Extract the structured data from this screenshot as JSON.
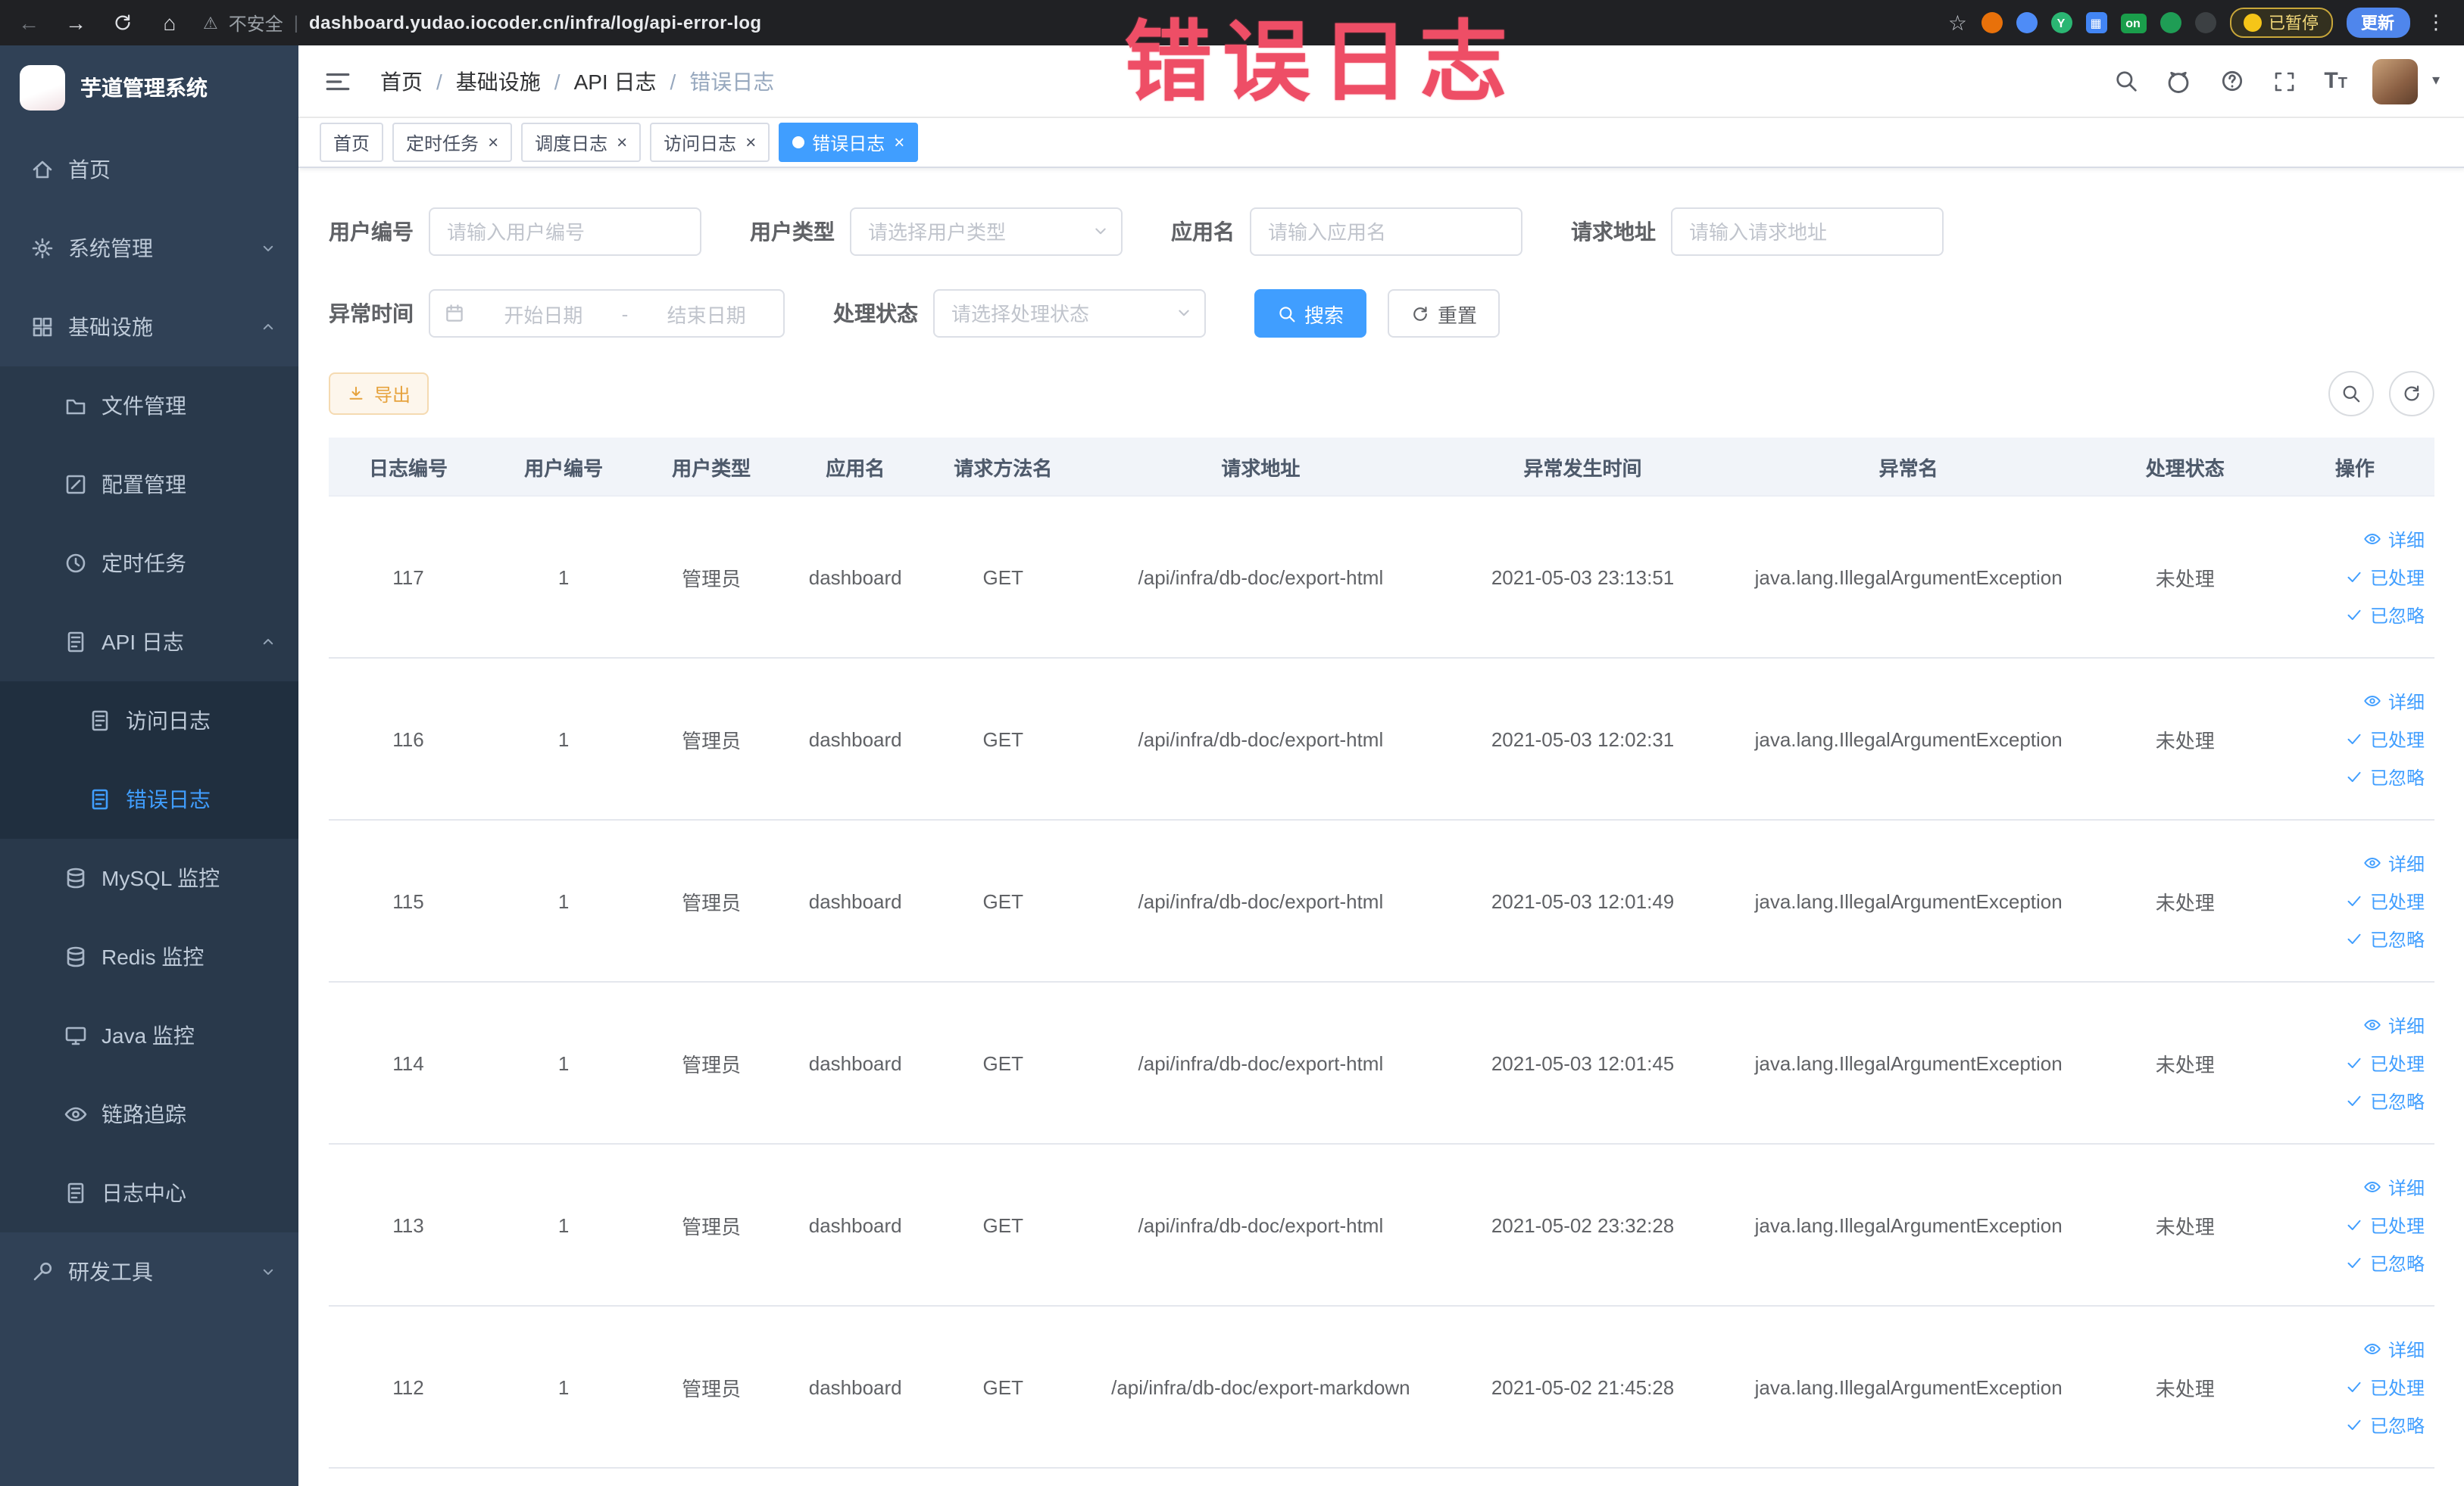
{
  "browser": {
    "security_label": "不安全",
    "url": "dashboard.yudao.iocoder.cn/infra/log/api-error-log",
    "paused_label": "已暂停",
    "update_label": "更新",
    "on_badge": "on"
  },
  "overlay": {
    "title": "错误日志"
  },
  "sidebar": {
    "logo_title": "芋道管理系统",
    "items": [
      {
        "key": "home",
        "label": "首页",
        "icon": "home",
        "level": 1
      },
      {
        "key": "system-mgmt",
        "label": "系统管理",
        "icon": "gear",
        "level": 1,
        "arrow": "down"
      },
      {
        "key": "infrastructure",
        "label": "基础设施",
        "icon": "grid",
        "level": 1,
        "arrow": "up"
      },
      {
        "key": "file-mgmt",
        "label": "文件管理",
        "icon": "folder",
        "level": 2
      },
      {
        "key": "config-mgmt",
        "label": "配置管理",
        "icon": "edit",
        "level": 2
      },
      {
        "key": "scheduled-task",
        "label": "定时任务",
        "icon": "clock",
        "level": 2
      },
      {
        "key": "api-log",
        "label": "API 日志",
        "icon": "doc",
        "level": 2,
        "arrow": "up"
      },
      {
        "key": "access-log",
        "label": "访问日志",
        "icon": "doc",
        "level": 3
      },
      {
        "key": "error-log",
        "label": "错误日志",
        "icon": "doc",
        "level": 3,
        "active": true
      },
      {
        "key": "mysql-monitor",
        "label": "MySQL 监控",
        "icon": "db",
        "level": 2
      },
      {
        "key": "redis-monitor",
        "label": "Redis 监控",
        "icon": "db",
        "level": 2
      },
      {
        "key": "java-monitor",
        "label": "Java 监控",
        "icon": "monitor",
        "level": 2
      },
      {
        "key": "trace",
        "label": "链路追踪",
        "icon": "eye",
        "level": 2
      },
      {
        "key": "log-center",
        "label": "日志中心",
        "icon": "doc",
        "level": 2
      },
      {
        "key": "dev-tools",
        "label": "研发工具",
        "icon": "wrench",
        "level": 1,
        "arrow": "down"
      }
    ]
  },
  "breadcrumb": [
    "首页",
    "基础设施",
    "API 日志",
    "错误日志"
  ],
  "tabs": [
    {
      "key": "home",
      "label": "首页",
      "closable": false,
      "active": false
    },
    {
      "key": "scheduled-task",
      "label": "定时任务",
      "closable": true,
      "active": false
    },
    {
      "key": "schedule-log",
      "label": "调度日志",
      "closable": true,
      "active": false
    },
    {
      "key": "access-log",
      "label": "访问日志",
      "closable": true,
      "active": false
    },
    {
      "key": "error-log",
      "label": "错误日志",
      "closable": true,
      "active": true
    }
  ],
  "filters": {
    "user_id": {
      "label": "用户编号",
      "placeholder": "请输入用户编号"
    },
    "user_type": {
      "label": "用户类型",
      "placeholder": "请选择用户类型"
    },
    "app_name": {
      "label": "应用名",
      "placeholder": "请输入应用名"
    },
    "request_url": {
      "label": "请求地址",
      "placeholder": "请输入请求地址"
    },
    "exception_time": {
      "label": "异常时间",
      "start": "开始日期",
      "separator": "-",
      "end": "结束日期"
    },
    "process_status": {
      "label": "处理状态",
      "placeholder": "请选择处理状态"
    },
    "search_label": "搜索",
    "reset_label": "重置"
  },
  "toolbar": {
    "export_label": "导出"
  },
  "table": {
    "columns": [
      "日志编号",
      "用户编号",
      "用户类型",
      "应用名",
      "请求方法名",
      "请求地址",
      "异常发生时间",
      "异常名",
      "处理状态",
      "操作"
    ],
    "row_keys": [
      "id",
      "user_id",
      "user_type",
      "app",
      "method",
      "url",
      "time",
      "exception",
      "status"
    ],
    "actions": [
      "详细",
      "已处理",
      "已忽略"
    ],
    "rows": [
      {
        "id": "117",
        "user_id": "1",
        "user_type": "管理员",
        "app": "dashboard",
        "method": "GET",
        "url": "/api/infra/db-doc/export-html",
        "time": "2021-05-03 23:13:51",
        "exception": "java.lang.IllegalArgumentException",
        "status": "未处理"
      },
      {
        "id": "116",
        "user_id": "1",
        "user_type": "管理员",
        "app": "dashboard",
        "method": "GET",
        "url": "/api/infra/db-doc/export-html",
        "time": "2021-05-03 12:02:31",
        "exception": "java.lang.IllegalArgumentException",
        "status": "未处理"
      },
      {
        "id": "115",
        "user_id": "1",
        "user_type": "管理员",
        "app": "dashboard",
        "method": "GET",
        "url": "/api/infra/db-doc/export-html",
        "time": "2021-05-03 12:01:49",
        "exception": "java.lang.IllegalArgumentException",
        "status": "未处理"
      },
      {
        "id": "114",
        "user_id": "1",
        "user_type": "管理员",
        "app": "dashboard",
        "method": "GET",
        "url": "/api/infra/db-doc/export-html",
        "time": "2021-05-03 12:01:45",
        "exception": "java.lang.IllegalArgumentException",
        "status": "未处理"
      },
      {
        "id": "113",
        "user_id": "1",
        "user_type": "管理员",
        "app": "dashboard",
        "method": "GET",
        "url": "/api/infra/db-doc/export-html",
        "time": "2021-05-02 23:32:28",
        "exception": "java.lang.IllegalArgumentException",
        "status": "未处理"
      },
      {
        "id": "112",
        "user_id": "1",
        "user_type": "管理员",
        "app": "dashboard",
        "method": "GET",
        "url": "/api/infra/db-doc/export-markdown",
        "time": "2021-05-02 21:45:28",
        "exception": "java.lang.IllegalArgumentException",
        "status": "未处理"
      }
    ]
  }
}
